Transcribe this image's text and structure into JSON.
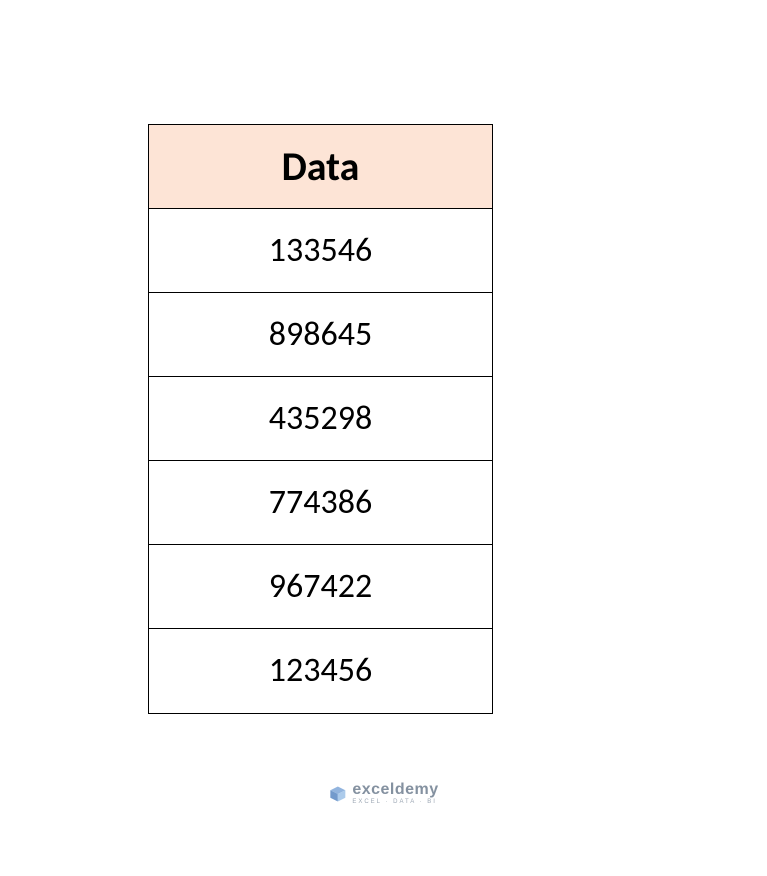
{
  "table": {
    "header": "Data",
    "rows": [
      "133546",
      "898645",
      "435298",
      "774386",
      "967422",
      "123456"
    ]
  },
  "watermark": {
    "name": "exceldemy",
    "tagline": "EXCEL · DATA · BI"
  },
  "chart_data": {
    "type": "table",
    "title": "Data",
    "columns": [
      "Data"
    ],
    "rows": [
      [
        133546
      ],
      [
        898645
      ],
      [
        435298
      ],
      [
        774386
      ],
      [
        967422
      ],
      [
        123456
      ]
    ]
  }
}
